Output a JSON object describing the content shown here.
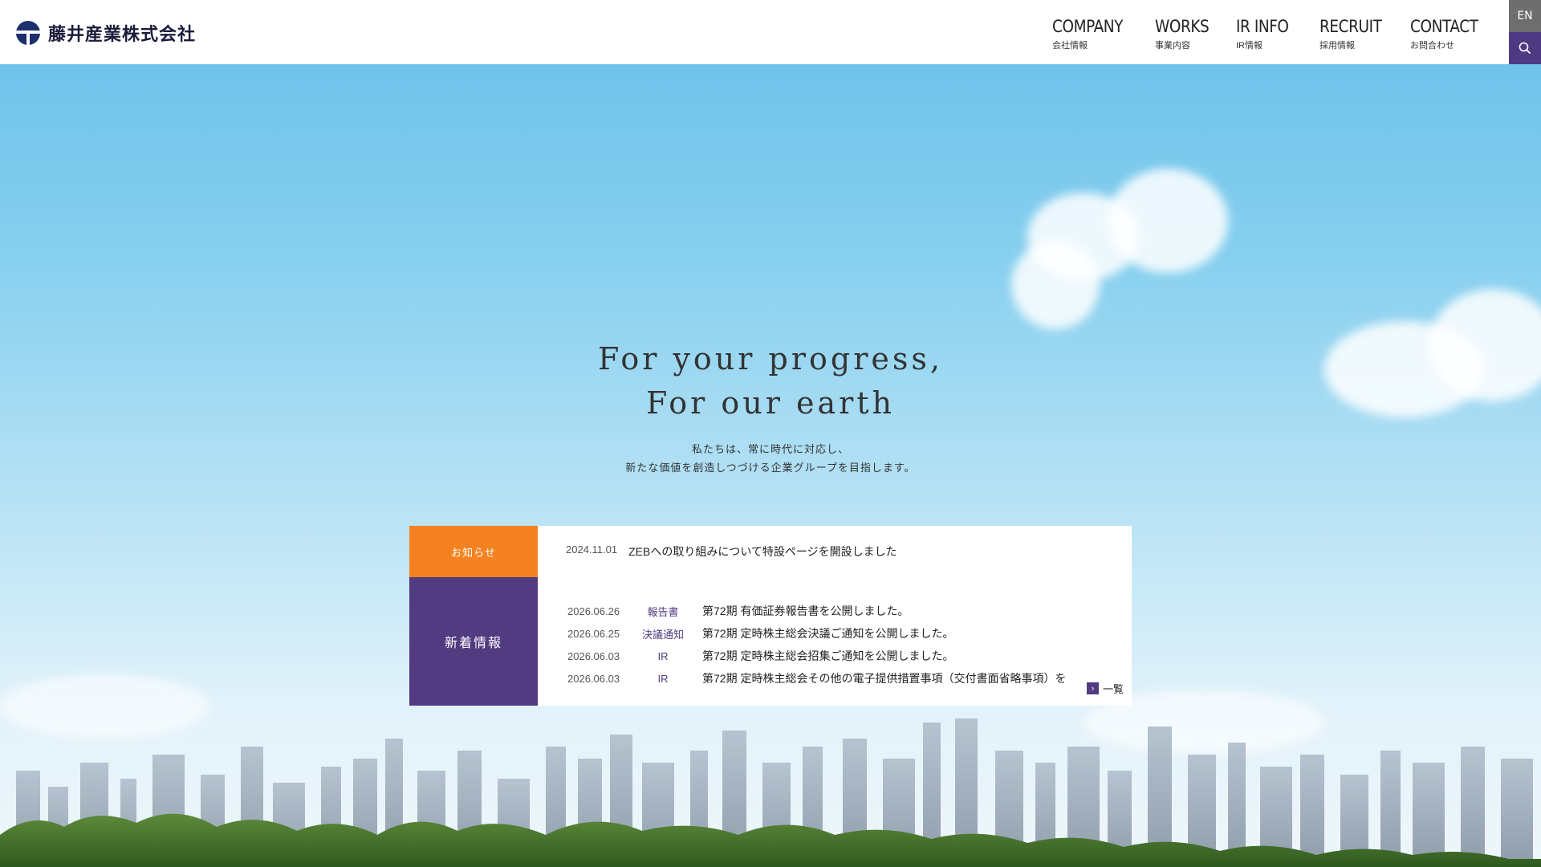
{
  "header": {
    "company_name": "藤井産業株式会社",
    "nav": [
      {
        "en": "COMPANY",
        "ja": "会社情報"
      },
      {
        "en": "WORKS",
        "ja": "事業内容"
      },
      {
        "en": "IR INFO",
        "ja": "IR情報"
      },
      {
        "en": "RECRUIT",
        "ja": "採用情報"
      },
      {
        "en": "CONTACT",
        "ja": "お問合わせ"
      }
    ],
    "lang_label": "EN",
    "search_icon": "search-icon"
  },
  "hero": {
    "tagline_line1": "For your progress,",
    "tagline_line2": "For our earth",
    "sub_line1": "私たちは、常に時代に対応し、",
    "sub_line2": "新たな価値を創造しつづける企業グループを目指します。"
  },
  "news": {
    "notice_label": "お知らせ",
    "notice": {
      "date": "2024.11.01",
      "title": "ZEBへの取り組みについて特設ページを開設しました"
    },
    "latest_label": "新着情報",
    "items": [
      {
        "date": "2026.06.26",
        "category": "報告書",
        "title": "第72期 有価証券報告書を公開しました。"
      },
      {
        "date": "2026.06.25",
        "category": "決議通知",
        "title": "第72期 定時株主総会決議ご通知を公開しました。"
      },
      {
        "date": "2026.06.03",
        "category": "IR",
        "title": "第72期 定時株主総会招集ご通知を公開しました。"
      },
      {
        "date": "2026.06.03",
        "category": "IR",
        "title": "第72期 定時株主総会その他の電子提供措置事項（交付書面省略事項）を"
      }
    ],
    "more_label": "一覧"
  },
  "colors": {
    "notice": "#f58220",
    "latest": "#523b80",
    "search_bg": "#4e3a82"
  }
}
